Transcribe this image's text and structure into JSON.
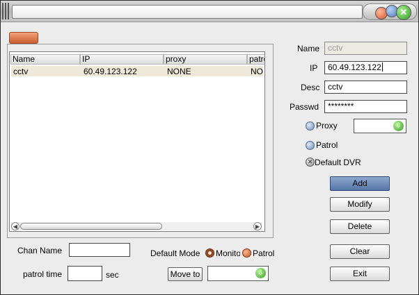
{
  "window": {
    "title": ""
  },
  "titlebar_controls": {
    "close_glyph": "✕"
  },
  "list": {
    "columns": [
      "Name",
      "IP",
      "proxy",
      "patrol"
    ],
    "rows": [
      {
        "name": "cctv",
        "ip": "60.49.123.122",
        "proxy": "NONE",
        "patrol": "NO"
      }
    ],
    "scroll_left": "◀",
    "scroll_right": "▶"
  },
  "form": {
    "name_label": "Name",
    "name_value": "cctv",
    "ip_label": "IP",
    "ip_value": "60.49.123.122",
    "desc_label": "Desc",
    "desc_value": "cctv",
    "passwd_label": "Passwd",
    "passwd_value": "********",
    "proxy_label": "Proxy",
    "proxy_value": "",
    "patrol_label": "Patrol",
    "default_dvr_label": "Default DVR"
  },
  "buttons": {
    "add": "Add",
    "modify": "Modify",
    "delete": "Delete",
    "clear": "Clear",
    "exit": "Exit",
    "move_to": "Move to"
  },
  "bottom": {
    "chan_name_label": "Chan Name",
    "chan_name_value": "",
    "patrol_time_label": "patrol time",
    "patrol_time_value": "",
    "sec_label": "sec",
    "default_mode_label": "Default Mode",
    "monitor_label": "Monitor",
    "patrol_label": "Patrol",
    "move_to_value": ""
  },
  "icons": {
    "dropdown": "⇩",
    "unchecked_x": "✕"
  }
}
